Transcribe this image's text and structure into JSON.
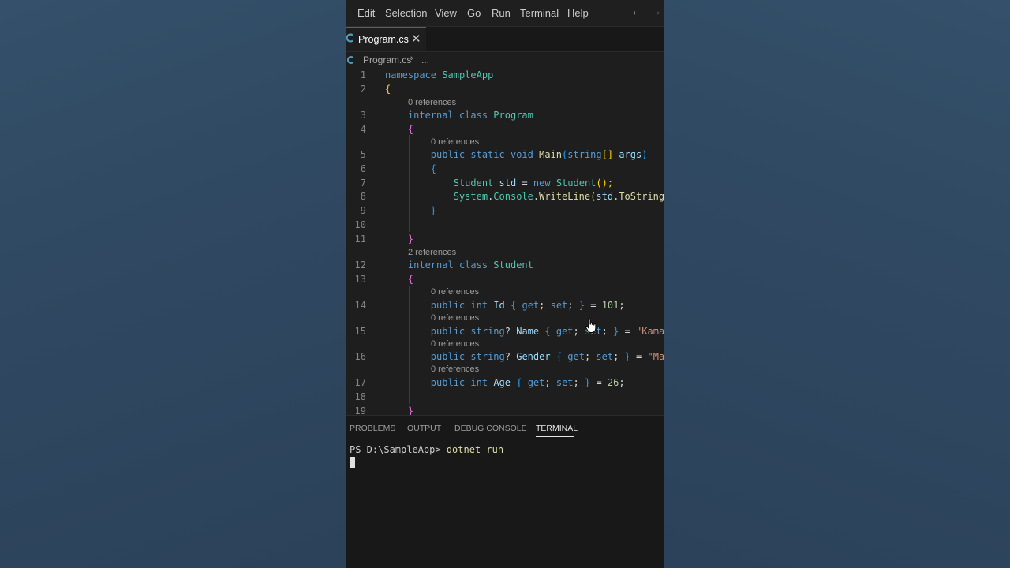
{
  "menu": {
    "items": [
      "Edit",
      "Selection",
      "View",
      "Go",
      "Run",
      "Terminal",
      "Help"
    ],
    "back_icon": "arrow-left-icon",
    "forward_icon": "arrow-right-icon"
  },
  "tab": {
    "filename": "Program.cs",
    "icon": "csharp-file-icon",
    "close_icon": "close-icon"
  },
  "breadcrumb": {
    "file": "Program.cs",
    "separator": "›",
    "more": "..."
  },
  "line_numbers": [
    "1",
    "2",
    "3",
    "4",
    "5",
    "6",
    "7",
    "8",
    "9",
    "10",
    "11",
    "12",
    "13",
    "14",
    "15",
    "16",
    "17",
    "18",
    "19"
  ],
  "codelens": {
    "program": "0 references",
    "main": "0 references",
    "student": "2 references",
    "id": "0 references",
    "name": "0 references",
    "gender": "0 references",
    "age": "0 references"
  },
  "code": {
    "l1": {
      "kw": "namespace",
      "name": "SampleApp"
    },
    "l2": {
      "brace": "{"
    },
    "l3": {
      "kw1": "internal",
      "kw2": "class",
      "name": "Program"
    },
    "l4": {
      "brace": "{"
    },
    "l5": {
      "kw1": "public",
      "kw2": "static",
      "kw3": "void",
      "fn": "Main",
      "open": "(",
      "type": "string",
      "arr": "[]",
      "arg": "args",
      "close": ")"
    },
    "l6": {
      "brace": "{"
    },
    "l7": {
      "type": "Student",
      "var": "std",
      "eq": "=",
      "kw": "new",
      "ctor": "Student",
      "tail": "();"
    },
    "l8": {
      "sys": "System",
      "dot1": ".",
      "cons": "Console",
      "dot2": ".",
      "fn": "WriteLine",
      "open": "(",
      "var": "std",
      "dot3": ".",
      "fn2": "ToString"
    },
    "l9": {
      "brace": "}"
    },
    "l11": {
      "brace": "}"
    },
    "l12": {
      "kw1": "internal",
      "kw2": "class",
      "name": "Student"
    },
    "l13": {
      "brace": "{"
    },
    "l14": {
      "kw1": "public",
      "type": "int",
      "prop": "Id",
      "ob": "{",
      "get": "get",
      "set": "set",
      "cb": "}",
      "eq": "=",
      "val": "101",
      "semi": ";"
    },
    "l15": {
      "kw1": "public",
      "type": "string",
      "q": "?",
      "prop": "Name",
      "ob": "{",
      "get": "get",
      "set": "set",
      "cb": "}",
      "eq": "=",
      "val": "\"Kama"
    },
    "l16": {
      "kw1": "public",
      "type": "string",
      "q": "?",
      "prop": "Gender",
      "ob": "{",
      "get": "get",
      "set": "set",
      "cb": "}",
      "eq": "=",
      "val": "\"Ma"
    },
    "l17": {
      "kw1": "public",
      "type": "int",
      "prop": "Age",
      "ob": "{",
      "get": "get",
      "set": "set",
      "cb": "}",
      "eq": "=",
      "val": "26",
      "semi": ";"
    },
    "l19": {
      "brace": "}"
    }
  },
  "panel": {
    "tabs": [
      "PROBLEMS",
      "OUTPUT",
      "DEBUG CONSOLE",
      "TERMINAL"
    ],
    "active_tab": "TERMINAL"
  },
  "terminal": {
    "prompt": "PS D:\\SampleApp>",
    "command": "dotnet run"
  },
  "colors": {
    "keyword": "#569cd6",
    "type": "#4ec9b0",
    "function": "#dcdcaa",
    "variable": "#9cdcfe",
    "string": "#ce9178",
    "number": "#b5cea8",
    "accent": "#0078d4"
  }
}
